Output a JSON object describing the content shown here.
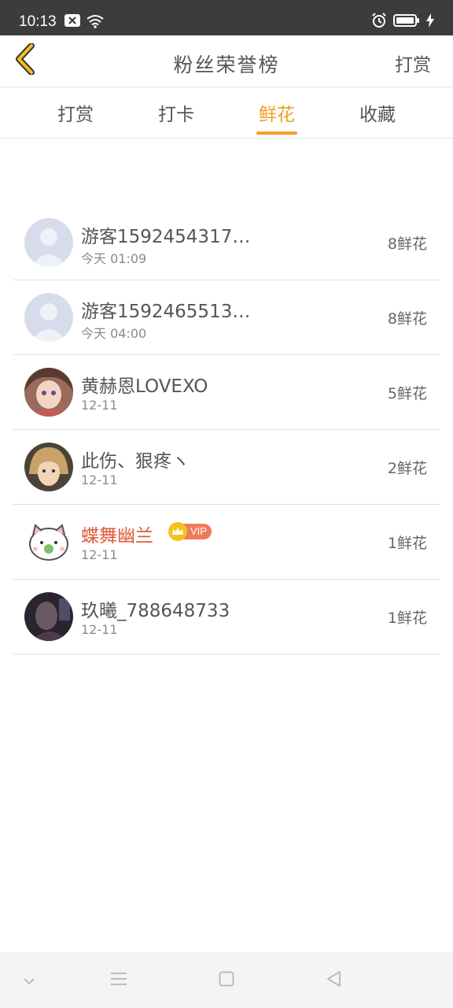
{
  "status_bar": {
    "time": "10:13"
  },
  "header": {
    "title": "粉丝荣誉榜",
    "right_action": "打赏"
  },
  "tabs": [
    {
      "label": "打赏",
      "active": false
    },
    {
      "label": "打卡",
      "active": false
    },
    {
      "label": "鲜花",
      "active": true
    },
    {
      "label": "收藏",
      "active": false
    }
  ],
  "fans": [
    {
      "name": "游客1592454317…",
      "time": "今天 01:09",
      "count": "8鲜花",
      "vip": false
    },
    {
      "name": "游客1592465513…",
      "time": "今天 04:00",
      "count": "8鲜花",
      "vip": false
    },
    {
      "name": "黄赫恩LOVEXO",
      "time": "12-11",
      "count": "5鲜花",
      "vip": false
    },
    {
      "name": "此伤、狠疼ヽ",
      "time": "12-11",
      "count": "2鲜花",
      "vip": false
    },
    {
      "name": "蝶舞幽兰",
      "time": "12-11",
      "count": "1鲜花",
      "vip": true,
      "vip_label": "VIP"
    },
    {
      "name": "玖曦_788648733",
      "time": "12-11",
      "count": "1鲜花",
      "vip": false
    }
  ],
  "colors": {
    "accent": "#f0a020",
    "vip_name": "#e05a38",
    "status_bar": "#3c3c3c"
  }
}
